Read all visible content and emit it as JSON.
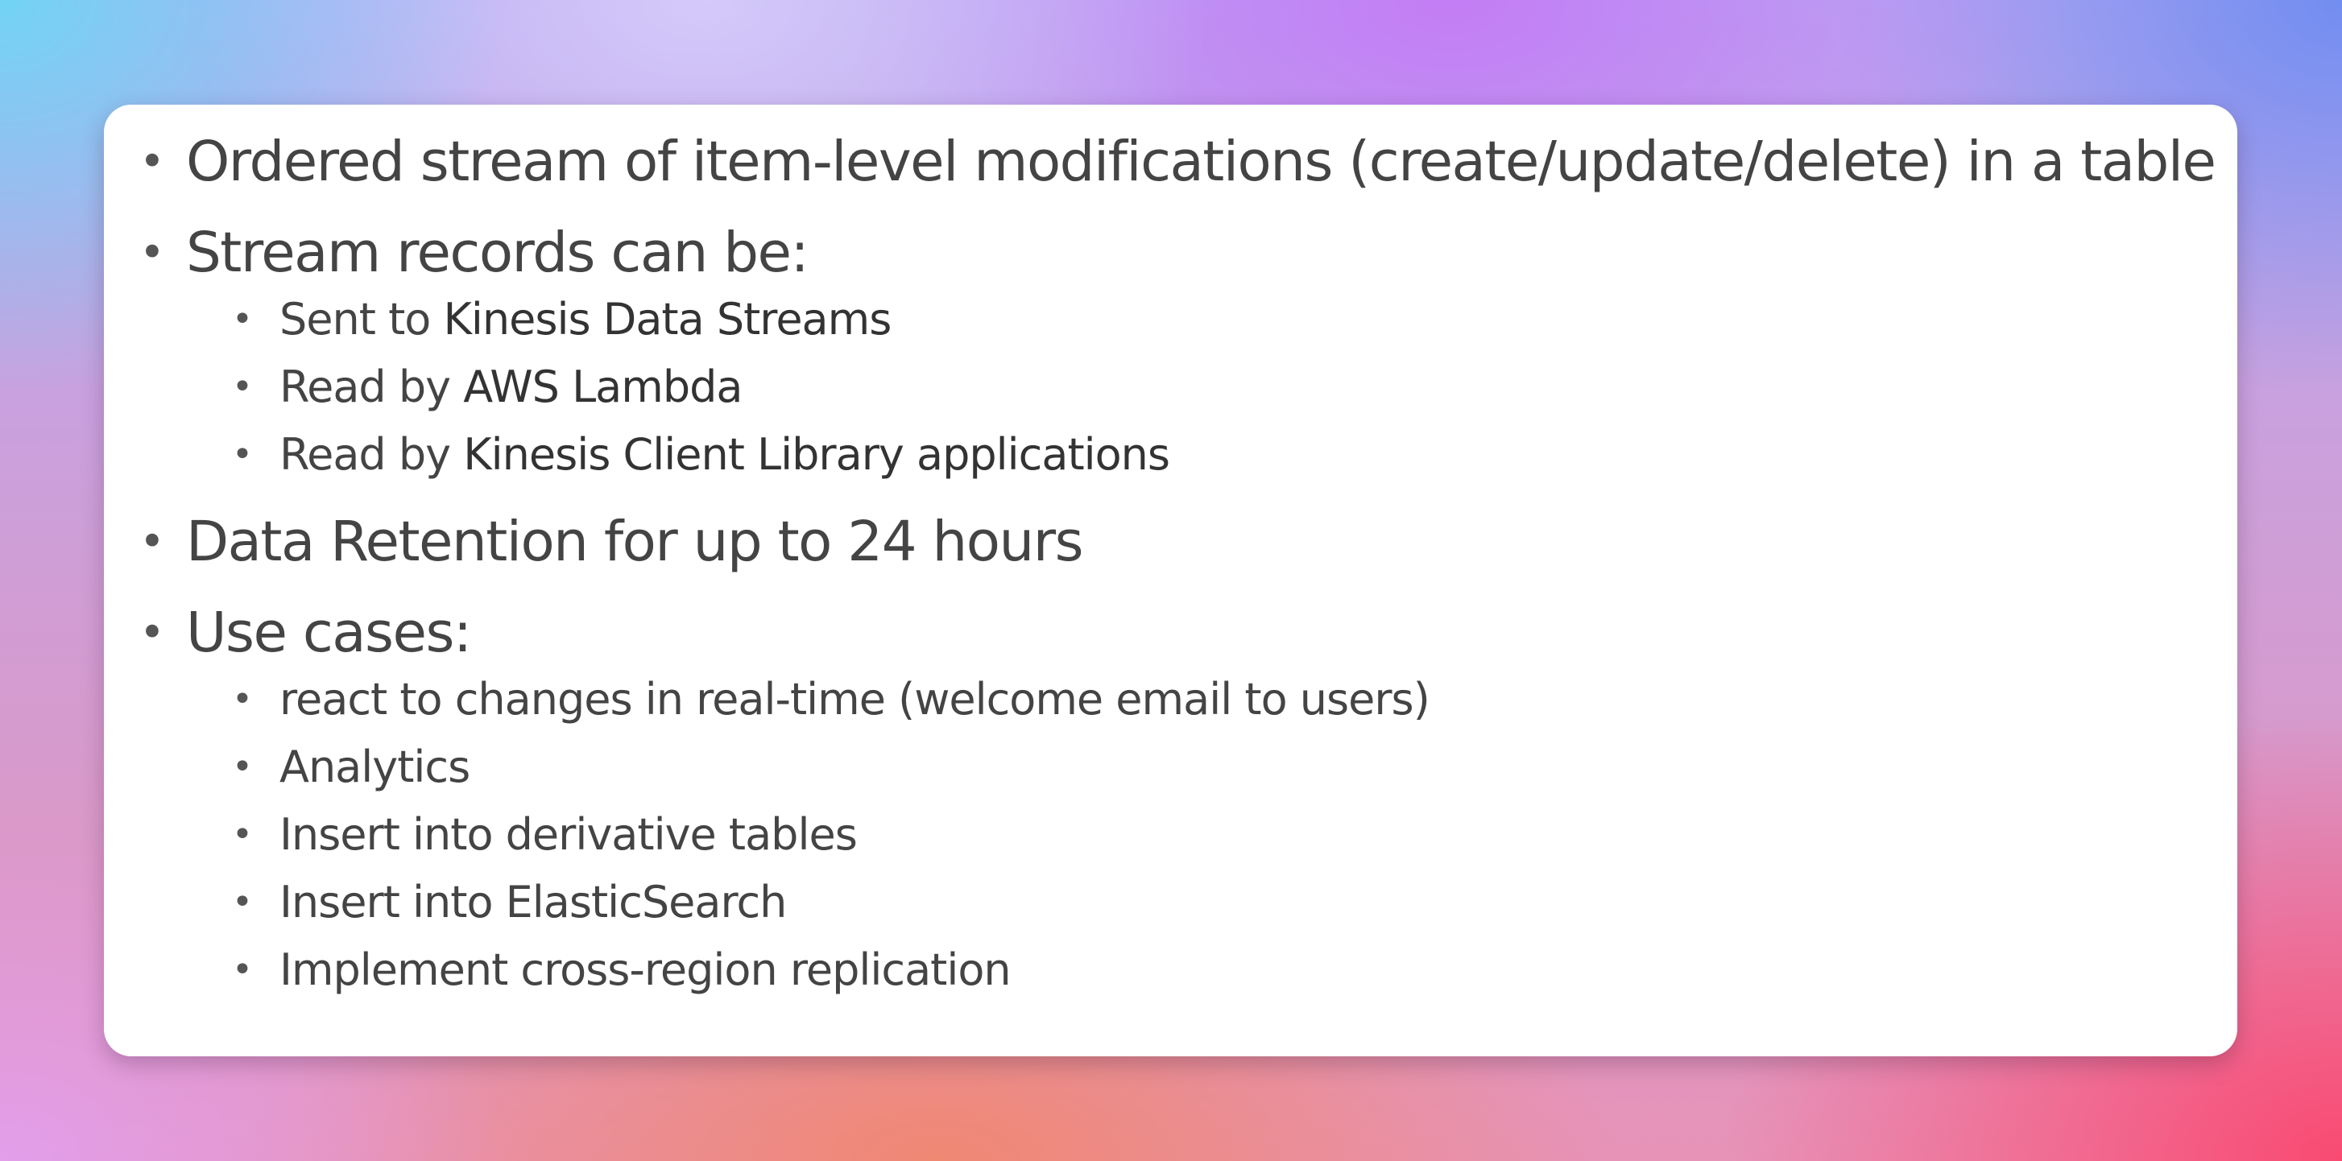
{
  "bullets": {
    "item1": "Ordered stream of item-level modifications (create/update/delete) in a table",
    "item2": "Stream records can be:",
    "item2_sub": [
      {
        "prefix": "Sent to ",
        "highlight": "Kinesis Data Streams"
      },
      {
        "prefix": "Read by ",
        "highlight": "AWS Lambda"
      },
      {
        "prefix": "Read by ",
        "highlight": "Kinesis Client Library applications"
      }
    ],
    "item3": "Data Retention for up to 24 hours",
    "item4": "Use cases:",
    "item4_sub": [
      "react to changes in real-time (welcome email to users)",
      "Analytics",
      "Insert into derivative tables",
      "Insert into ElasticSearch",
      "Implement cross-region replication"
    ]
  }
}
